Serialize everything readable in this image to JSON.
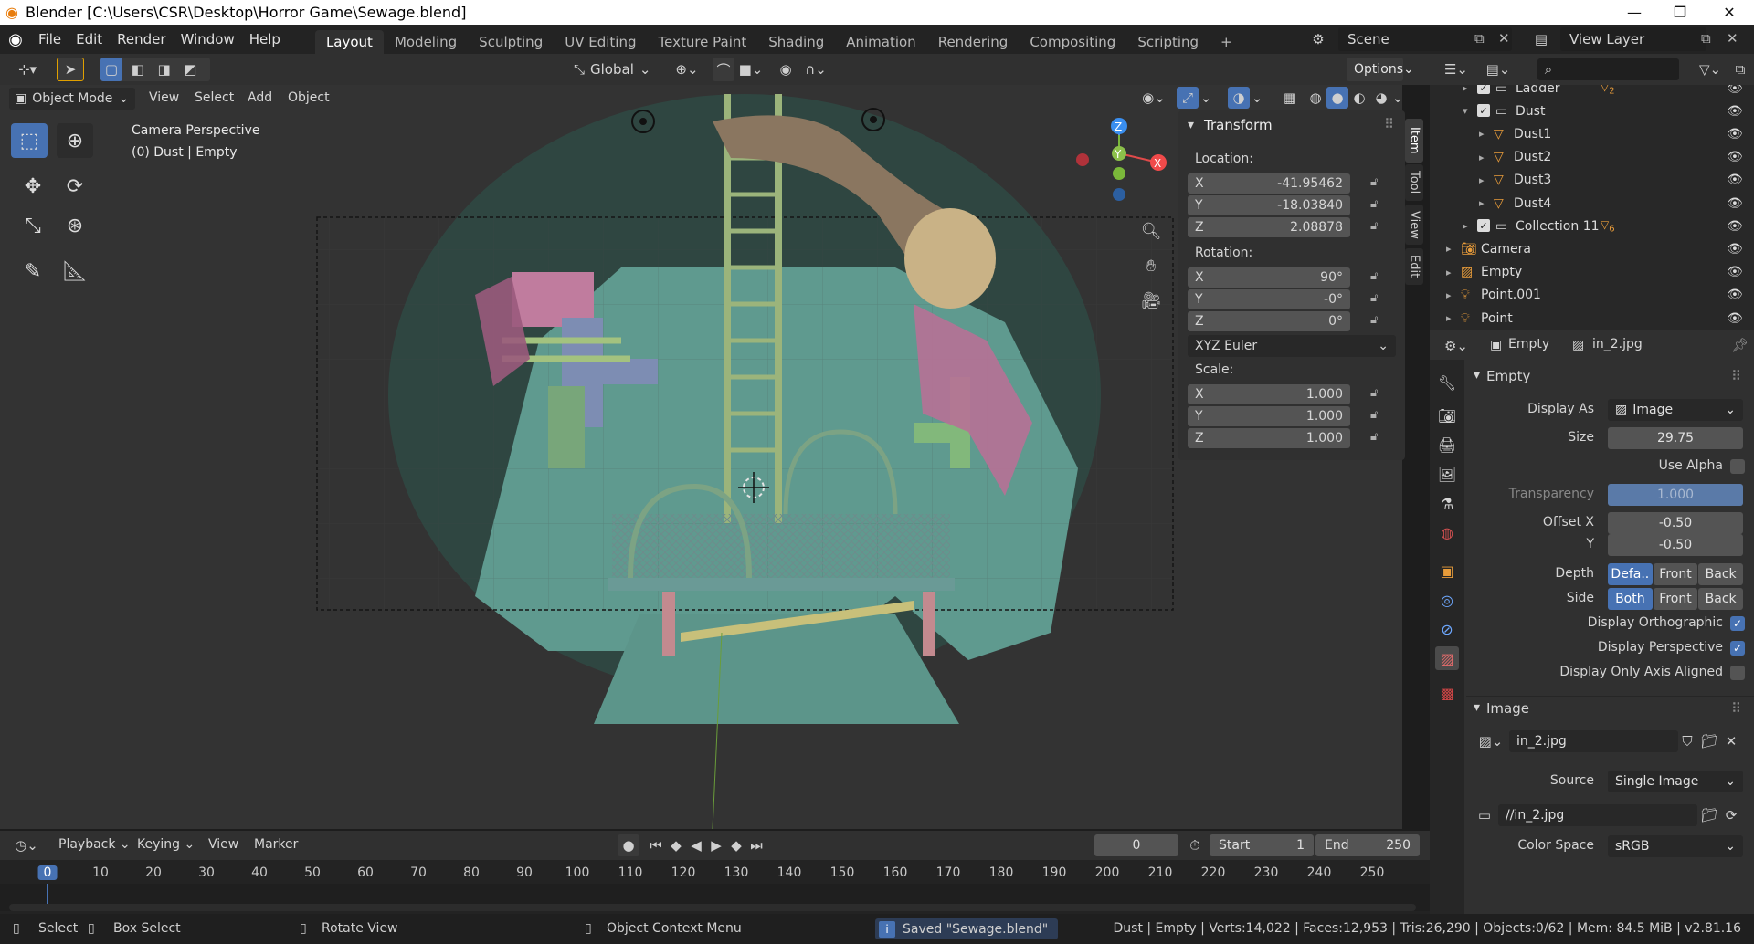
{
  "window": {
    "title": "Blender [C:\\Users\\CSR\\Desktop\\Horror Game\\Sewage.blend]",
    "minimize": "—",
    "maximize": "❐",
    "close": "✕"
  },
  "menu": [
    "File",
    "Edit",
    "Render",
    "Window",
    "Help"
  ],
  "workspaces": [
    "Layout",
    "Modeling",
    "Sculpting",
    "UV Editing",
    "Texture Paint",
    "Shading",
    "Animation",
    "Rendering",
    "Compositing",
    "Scripting"
  ],
  "add_workspace": "+",
  "scene": {
    "label": "Scene",
    "view_layer": "View Layer"
  },
  "header": {
    "orientation": "Global",
    "options": "Options"
  },
  "viewport_header": {
    "mode": "Object Mode",
    "menus": [
      "View",
      "Select",
      "Add",
      "Object"
    ]
  },
  "viewport": {
    "camera_label": "Camera Perspective",
    "object_label": "(0) Dust | Empty",
    "axis": {
      "x": "X",
      "y": "Y",
      "z": "Z"
    }
  },
  "transform": {
    "title": "Transform",
    "location_label": "Location:",
    "location": [
      {
        "axis": "X",
        "value": "-41.95462"
      },
      {
        "axis": "Y",
        "value": "-18.03840"
      },
      {
        "axis": "Z",
        "value": "2.08878"
      }
    ],
    "rotation_label": "Rotation:",
    "rotation": [
      {
        "axis": "X",
        "value": "90°"
      },
      {
        "axis": "Y",
        "value": "-0°"
      },
      {
        "axis": "Z",
        "value": "0°"
      }
    ],
    "rotation_mode": "XYZ Euler",
    "scale_label": "Scale:",
    "scale": [
      {
        "axis": "X",
        "value": "1.000"
      },
      {
        "axis": "Y",
        "value": "1.000"
      },
      {
        "axis": "Z",
        "value": "1.000"
      }
    ]
  },
  "npanel_tabs": [
    "Item",
    "Tool",
    "View",
    "Edit"
  ],
  "outliner": {
    "rows": [
      {
        "name": "Ladder",
        "icon": "collection-icon",
        "badge": "2"
      },
      {
        "name": "Dust",
        "icon": "collection-icon"
      },
      {
        "name": "Dust1",
        "icon": "mesh-icon"
      },
      {
        "name": "Dust2",
        "icon": "mesh-icon"
      },
      {
        "name": "Dust3",
        "icon": "mesh-icon"
      },
      {
        "name": "Dust4",
        "icon": "mesh-icon"
      },
      {
        "name": "Collection 11",
        "icon": "collection-icon",
        "badge": "6"
      },
      {
        "name": "Camera",
        "icon": "camera-icon"
      },
      {
        "name": "Empty",
        "icon": "empty-image-icon"
      },
      {
        "name": "Point.001",
        "icon": "light-icon"
      },
      {
        "name": "Point",
        "icon": "light-icon"
      }
    ]
  },
  "properties": {
    "header": {
      "object": "Empty",
      "data": "in_2.jpg"
    },
    "empty_section": "Empty",
    "display_as_label": "Display As",
    "display_as": "Image",
    "size_label": "Size",
    "size": "29.75",
    "use_alpha": "Use Alpha",
    "transparency_label": "Transparency",
    "transparency": "1.000",
    "offset_x_label": "Offset X",
    "offset_x": "-0.50",
    "offset_y_label": "Y",
    "offset_y": "-0.50",
    "depth_label": "Depth",
    "depth_options": [
      "Defa..",
      "Front",
      "Back"
    ],
    "side_label": "Side",
    "side_options": [
      "Both",
      "Front",
      "Back"
    ],
    "display_orthographic": "Display Orthographic",
    "display_perspective": "Display Perspective",
    "display_axis_aligned": "Display Only Axis Aligned",
    "image_section": "Image",
    "image_name": "in_2.jpg",
    "source_label": "Source",
    "source": "Single Image",
    "filepath": "//in_2.jpg",
    "color_space_label": "Color Space",
    "color_space": "sRGB"
  },
  "timeline": {
    "menus": [
      "Playback",
      "Keying",
      "View",
      "Marker"
    ],
    "current_frame": "0",
    "start_label": "Start",
    "start": "1",
    "end_label": "End",
    "end": "250",
    "ticks": [
      "0",
      "10",
      "20",
      "30",
      "40",
      "50",
      "60",
      "70",
      "80",
      "90",
      "100",
      "110",
      "120",
      "130",
      "140",
      "150",
      "160",
      "170",
      "180",
      "190",
      "200",
      "210",
      "220",
      "230",
      "240",
      "250"
    ]
  },
  "status": {
    "select": "Select",
    "box_select": "Box Select",
    "rotate_view": "Rotate View",
    "context_menu": "Object Context Menu",
    "saved": "Saved \"Sewage.blend\"",
    "stats": "Dust | Empty | Verts:14,022 | Faces:12,953 | Tris:26,290 | Objects:0/62 | Mem: 84.5 MiB | v2.81.16"
  },
  "colors": {
    "accent": "#4772b3",
    "panel": "#303030",
    "field": "#545454",
    "viewport": "#393939"
  }
}
